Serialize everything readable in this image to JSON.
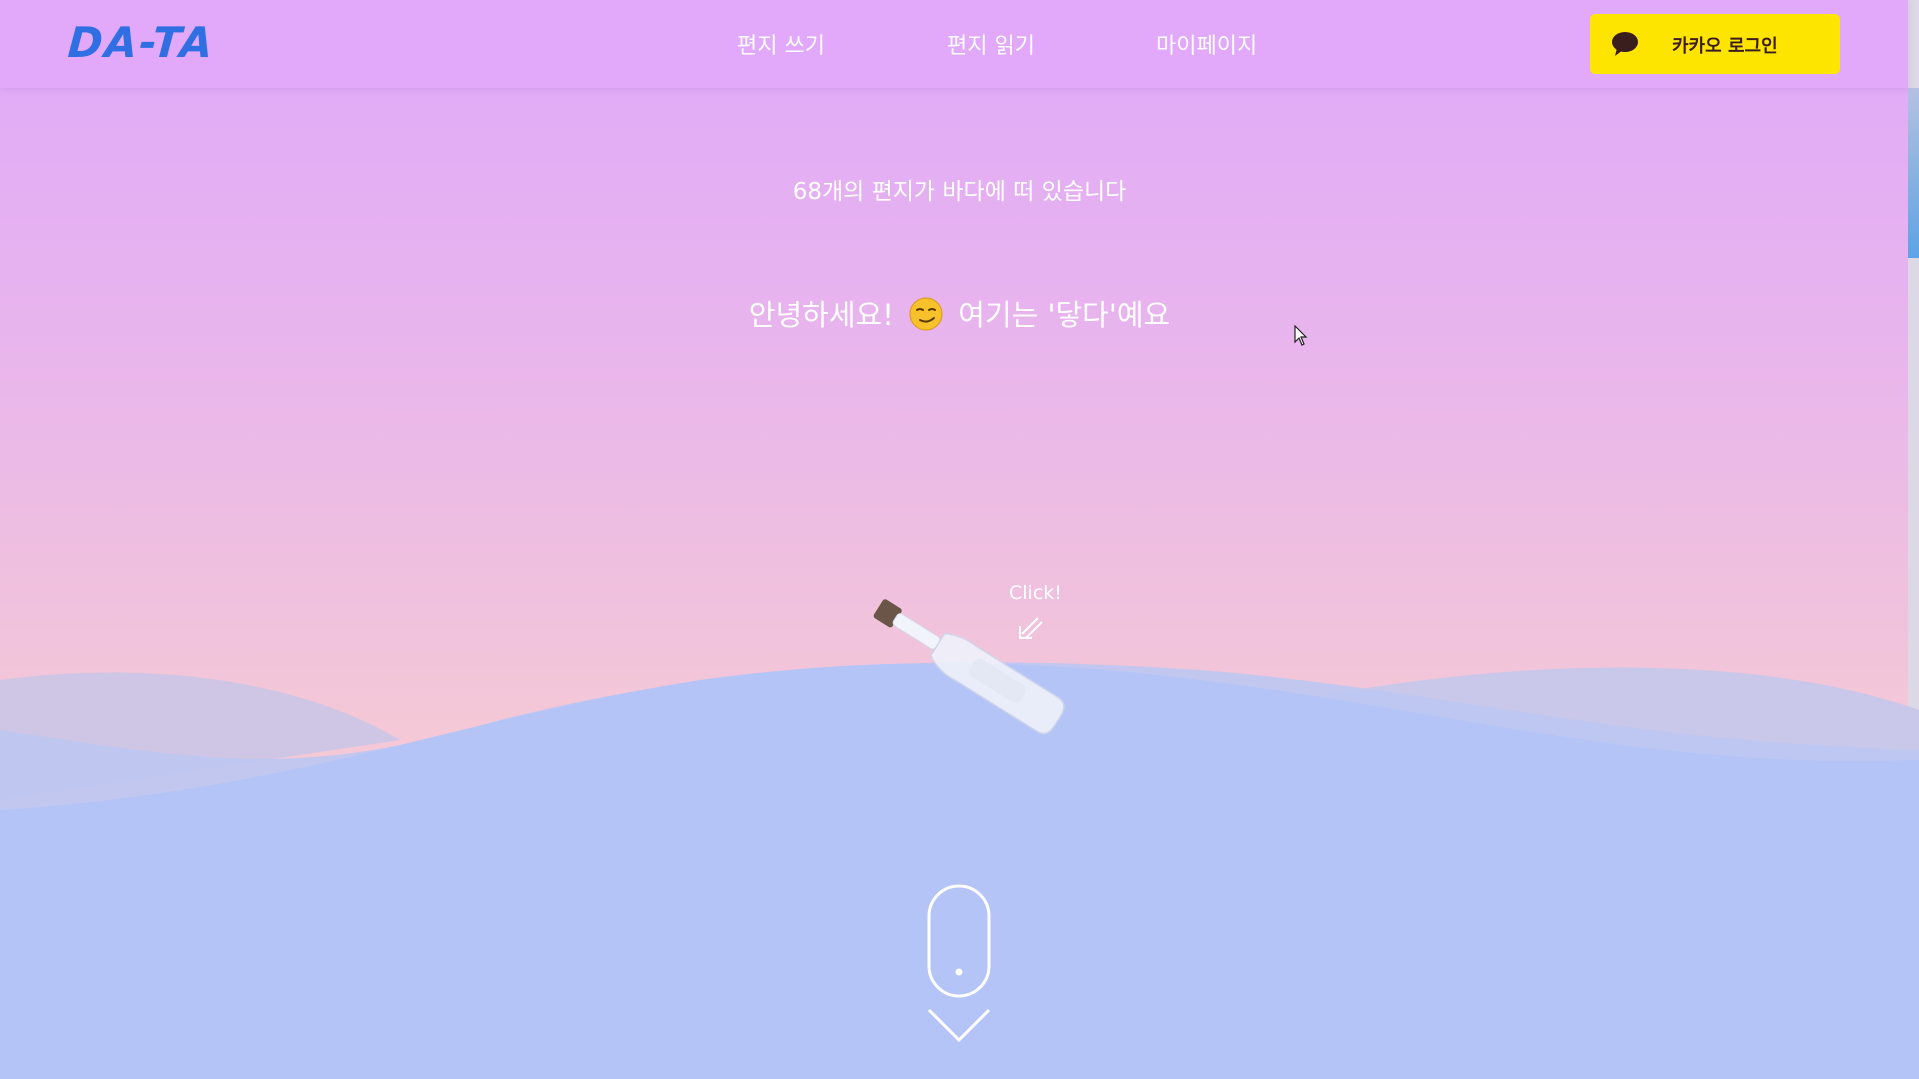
{
  "header": {
    "logo": "DA-TA",
    "nav": {
      "write": "편지 쓰기",
      "read": "편지 읽기",
      "mypage": "마이페이지"
    },
    "login_label": "카카오 로그인",
    "login_icon": "kakao-chat-bubble-icon"
  },
  "main": {
    "count_text": "68개의 편지가 바다에 떠 있습니다",
    "greeting_before": "안녕하세요!",
    "greeting_emoji": "smirking-face-emoji",
    "greeting_after": "여기는 '닿다'예요",
    "click_hint": "Click!"
  },
  "colors": {
    "header_bg": "#e2a9fa",
    "logo": "#2f6fe3",
    "kakao_yellow": "#fee500",
    "sea": "#b4c4f6",
    "text": "#ffffff"
  }
}
